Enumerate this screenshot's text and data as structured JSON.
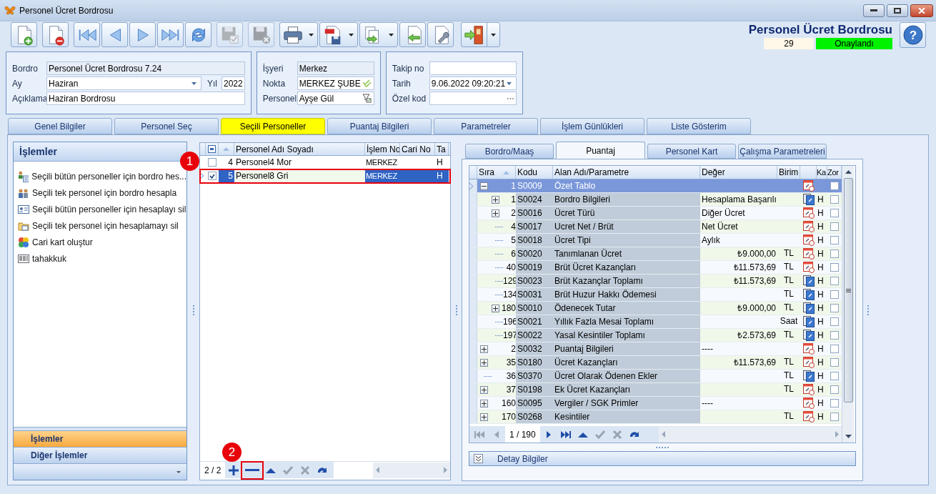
{
  "window": {
    "title": "Personel Ücret Bordrosu"
  },
  "toolbar": [
    {
      "kind": "new",
      "disabled": false,
      "dropdown": false
    },
    {
      "kind": "delete",
      "disabled": false,
      "dropdown": false
    },
    {
      "kind": "first",
      "disabled": false,
      "dropdown": false
    },
    {
      "kind": "prev",
      "disabled": false,
      "dropdown": false
    },
    {
      "kind": "next",
      "disabled": false,
      "dropdown": false
    },
    {
      "kind": "last",
      "disabled": false,
      "dropdown": false
    },
    {
      "kind": "refresh",
      "disabled": false,
      "dropdown": false
    },
    {
      "kind": "save",
      "disabled": true,
      "dropdown": false
    },
    {
      "kind": "cancel",
      "disabled": true,
      "dropdown": false
    },
    {
      "kind": "print",
      "disabled": false,
      "dropdown": true
    },
    {
      "kind": "pdf",
      "disabled": false,
      "dropdown": true
    },
    {
      "kind": "export",
      "disabled": false,
      "dropdown": true
    },
    {
      "kind": "import",
      "disabled": false,
      "dropdown": false
    },
    {
      "kind": "tools",
      "disabled": false,
      "dropdown": false
    },
    {
      "kind": "exit",
      "disabled": false,
      "dropdown": true
    }
  ],
  "header": {
    "title": "Personel Ücret Bordrosu",
    "number": "29",
    "status": "Onaylandı",
    "help": "?"
  },
  "form_groups": [
    {
      "rows": [
        [
          {
            "label": "Bordro",
            "value": "Personel Ücret Bordrosu 7.24",
            "kind": "readonly"
          }
        ],
        [
          {
            "label": "Ay",
            "value": "Haziran",
            "kind": "dropdown"
          },
          {
            "label": "Yıl",
            "value": "2022",
            "kind": "number"
          }
        ],
        [
          {
            "label": "Açıklama",
            "value": "Haziran Bordrosu",
            "kind": "text"
          }
        ]
      ]
    },
    {
      "rows": [
        [
          {
            "label": "İşyeri",
            "value": "Merkez",
            "kind": "readonly"
          }
        ],
        [
          {
            "label": "Nokta",
            "value": "MERKEZ ŞUBE",
            "kind": "validated"
          }
        ],
        [
          {
            "label": "Personel",
            "value": "Ayşe Gül",
            "kind": "lookup"
          }
        ]
      ]
    },
    {
      "rows": [
        [
          {
            "label": "Takip no",
            "kind": "text"
          }
        ],
        [
          {
            "label": "Tarih",
            "value": "9.06.2022 09:20:21",
            "kind": "dropdown"
          }
        ],
        [
          {
            "label": "Özel kod",
            "kind": "ellipsis"
          }
        ]
      ]
    }
  ],
  "main_tabs": [
    {
      "label": "Genel Bilgiler",
      "selected": false
    },
    {
      "label": "Personel Seç",
      "selected": false
    },
    {
      "label": "Seçili Personeller",
      "selected": true
    },
    {
      "label": "Puantaj Bilgileri",
      "selected": false
    },
    {
      "label": "Parametreler",
      "selected": false
    },
    {
      "label": "İşlem Günlükleri",
      "selected": false
    },
    {
      "label": "Liste Gösterim",
      "selected": false
    }
  ],
  "actions_panel": {
    "title": "İşlemler",
    "items": [
      {
        "label": "Seçili bütün personeller için bordro hes...",
        "kind": "calc-all"
      },
      {
        "label": "Seçili tek personel için bordro hesapla",
        "kind": "calc-one"
      },
      {
        "label": "Seçili bütün personeller için hesaplayı sil",
        "kind": "delete-all"
      },
      {
        "label": "Seçili tek personel için hesaplamayı sil",
        "kind": "delete-one"
      },
      {
        "label": "Cari kart oluştur",
        "kind": "account"
      },
      {
        "label": "tahakkuk",
        "kind": "accrual"
      }
    ],
    "nav": [
      {
        "label": "İşlemler",
        "selected": true
      },
      {
        "label": "Diğer İşlemler",
        "selected": false
      }
    ]
  },
  "personnel_grid": {
    "columns": [
      "Personel Adı Soyadı",
      "İşlem No",
      "Cari No",
      "Ta"
    ],
    "rows": [
      {
        "no": "4",
        "name": "Personel4 Mor",
        "process_no": "MERKEZ",
        "column_4": "H",
        "checked": false,
        "selected": false
      },
      {
        "no": "5",
        "name": "Personel8 Gri",
        "process_no": "MERKEZ",
        "column_4": "H",
        "checked": true,
        "selected": true
      }
    ],
    "navigator": {
      "position": "2 / 2",
      "buttons": [
        {
          "kind": "add",
          "disabled": false
        },
        {
          "kind": "remove",
          "disabled": false
        },
        {
          "kind": "up",
          "disabled": false
        },
        {
          "kind": "confirm",
          "disabled": true
        },
        {
          "kind": "cancel",
          "disabled": true
        },
        {
          "kind": "redo",
          "disabled": false
        }
      ]
    }
  },
  "detail_tabs": [
    {
      "label": "Bordro/Maaş",
      "selected": false
    },
    {
      "label": "Puantaj",
      "selected": true
    },
    {
      "label": "Personel Kart",
      "selected": false
    },
    {
      "label": "Çalışma Parametreleri",
      "selected": false
    }
  ],
  "params_grid": {
    "columns": [
      "Sıra",
      "Kodu",
      "Alan Adı/Parametre",
      "Değer",
      "Birim",
      "Ka",
      "Zor"
    ],
    "rows": [
      {
        "order": "1",
        "code": "S0009",
        "name": "Özet Tablo",
        "kind": "schedule",
        "checked": false,
        "selected": true,
        "expanded": true,
        "children": [
          {
            "order": "1",
            "code": "S0024",
            "name": "Bordro Bilgileri",
            "value": "Hesaplama Başarılı",
            "kind": "sheet",
            "column_6": "H",
            "checked": false,
            "selected": false,
            "expanded": false
          },
          {
            "order": "2",
            "code": "S0016",
            "name": "Ücret Türü",
            "value": "Diğer Ücret",
            "kind": "schedule",
            "column_6": "H",
            "checked": false,
            "selected": false,
            "expanded": false
          },
          {
            "order": "4",
            "code": "S0017",
            "name": "Ucret Net / Brüt",
            "value": "Net Ücret",
            "kind": "schedule",
            "column_6": "H",
            "checked": false,
            "selected": false
          },
          {
            "order": "5",
            "code": "S0018",
            "name": "Ücret Tipi",
            "value": "Aylık",
            "kind": "schedule",
            "column_6": "H",
            "checked": false,
            "selected": false
          },
          {
            "order": "6",
            "code": "S0020",
            "name": "Tanımlanan Ücret",
            "value": "₺9.000,00",
            "unit": "TL",
            "kind": "schedule",
            "column_6": "H",
            "checked": false,
            "selected": false
          },
          {
            "order": "40",
            "code": "S0019",
            "name": "Brüt Ücret Kazançları",
            "value": "₺11.573,69",
            "unit": "TL",
            "kind": "schedule",
            "column_6": "H",
            "checked": false,
            "selected": false
          },
          {
            "order": "129",
            "code": "S0023",
            "name": "Brüt Kazançlar Toplamı",
            "value": "₺11.573,69",
            "unit": "TL",
            "kind": "sheet",
            "column_6": "H",
            "checked": false,
            "selected": false
          },
          {
            "order": "134",
            "code": "S0031",
            "name": "Brüt Huzur Hakkı Ödemesi",
            "unit": "TL",
            "kind": "sheet",
            "column_6": "H",
            "checked": false,
            "selected": false
          },
          {
            "order": "180",
            "code": "S0010",
            "name": "Ödenecek Tutar",
            "value": "₺9.000,00",
            "unit": "TL",
            "kind": "sheet",
            "column_6": "H",
            "checked": false,
            "selected": false,
            "expanded": false
          },
          {
            "order": "196",
            "code": "S0021",
            "name": "Yıllık Fazla Mesai Toplamı",
            "unit": "Saat",
            "kind": "sheet",
            "column_6": "H",
            "checked": false,
            "selected": false
          },
          {
            "order": "197",
            "code": "S0022",
            "name": "Yasal Kesintiler Toplamı",
            "value": "₺2.573,69",
            "unit": "TL",
            "kind": "sheet",
            "column_6": "H",
            "checked": false,
            "selected": false
          }
        ]
      },
      {
        "order": "2",
        "code": "S0032",
        "name": "Puantaj Bilgileri",
        "value": "----",
        "kind": "schedule",
        "column_6": "H",
        "checked": false,
        "selected": false,
        "expanded": false
      },
      {
        "order": "35",
        "code": "S0180",
        "name": "Ücret Kazançları",
        "value": "₺11.573,69",
        "unit": "TL",
        "kind": "schedule",
        "column_6": "H",
        "checked": false,
        "selected": false,
        "expanded": false
      },
      {
        "order": "36",
        "code": "S0370",
        "name": "Ücret Olarak Ödenen Ekler",
        "unit": "TL",
        "kind": "sheet",
        "column_6": "H",
        "checked": false,
        "selected": false
      },
      {
        "order": "37",
        "code": "S0198",
        "name": "Ek Ücret Kazançları",
        "unit": "TL",
        "kind": "schedule",
        "column_6": "H",
        "checked": false,
        "selected": false,
        "expanded": false
      },
      {
        "order": "160",
        "code": "S0095",
        "name": "Vergiler / SGK Primler",
        "value": "----",
        "kind": "schedule",
        "column_6": "H",
        "checked": false,
        "selected": false,
        "expanded": false
      },
      {
        "order": "170",
        "code": "S0268",
        "name": "Kesintiler",
        "unit": "TL",
        "kind": "schedule",
        "column_6": "H",
        "checked": false,
        "selected": false,
        "expanded": false
      }
    ],
    "navigator": {
      "position": "1 / 190",
      "buttons": [
        {
          "kind": "first",
          "disabled": true
        },
        {
          "kind": "prev",
          "disabled": true
        },
        {
          "kind": "next",
          "disabled": false
        },
        {
          "kind": "last",
          "disabled": false
        },
        {
          "kind": "up",
          "disabled": false
        },
        {
          "kind": "confirm",
          "disabled": true
        },
        {
          "kind": "cancel",
          "disabled": true
        },
        {
          "kind": "redo",
          "disabled": false
        }
      ]
    }
  },
  "detail_bar": {
    "label": "Detay Bilgiler",
    "expanded": false
  },
  "annotations": [
    {
      "label": "1"
    },
    {
      "label": "2"
    }
  ]
}
